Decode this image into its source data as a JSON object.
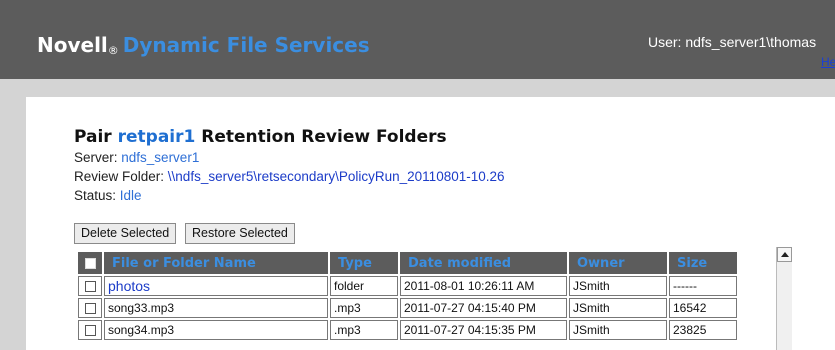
{
  "header": {
    "brand": "Novell",
    "reg_mark": "®",
    "product": "Dynamic File Services",
    "user_label": "User:",
    "user_name": "ndfs_server1\\thomas",
    "help": "Help"
  },
  "page": {
    "title_prefix": "Pair",
    "pair_name": "retpair1",
    "title_suffix": "Retention Review Folders",
    "server_label": "Server:",
    "server_value": "ndfs_server1",
    "review_label": "Review Folder:",
    "review_value": "\\\\ndfs_server5\\retsecondary\\PolicyRun_20110801-10.26",
    "status_label": "Status:",
    "status_value": "Idle"
  },
  "toolbar": {
    "delete_label": "Delete Selected",
    "restore_label": "Restore Selected"
  },
  "table": {
    "columns": [
      "File or Folder Name",
      "Type",
      "Date modified",
      "Owner",
      "Size"
    ],
    "rows": [
      {
        "name": "photos",
        "type": "folder",
        "date": "2011-08-01 10:26:11 AM",
        "owner": "JSmith",
        "size": "------"
      },
      {
        "name": "song33.mp3",
        "type": ".mp3",
        "date": "2011-07-27 04:15:40 PM",
        "owner": "JSmith",
        "size": "16542"
      },
      {
        "name": "song34.mp3",
        "type": ".mp3",
        "date": "2011-07-27 04:15:35 PM",
        "owner": "JSmith",
        "size": "23825"
      }
    ]
  },
  "colors": {
    "header_bg": "#5c5c5c",
    "accent": "#3b8ee0",
    "link": "#1c3cc8"
  }
}
